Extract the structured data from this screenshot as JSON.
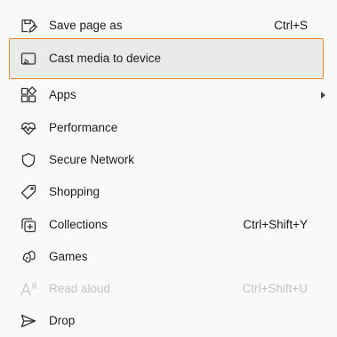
{
  "menu": {
    "items": [
      {
        "label": "Save page as",
        "shortcut": "Ctrl+S",
        "icon": "save-icon"
      },
      {
        "label": "Cast media to device",
        "shortcut": "",
        "icon": "cast-icon"
      },
      {
        "label": "Apps",
        "shortcut": "",
        "icon": "apps-icon",
        "has_submenu": true
      },
      {
        "label": "Performance",
        "shortcut": "",
        "icon": "performance-icon"
      },
      {
        "label": "Secure Network",
        "shortcut": "",
        "icon": "shield-icon"
      },
      {
        "label": "Shopping",
        "shortcut": "",
        "icon": "tag-icon"
      },
      {
        "label": "Collections",
        "shortcut": "Ctrl+Shift+Y",
        "icon": "collections-icon"
      },
      {
        "label": "Games",
        "shortcut": "",
        "icon": "games-icon"
      },
      {
        "label": "Read aloud",
        "shortcut": "Ctrl+Shift+U",
        "icon": "read-aloud-icon",
        "disabled": true
      },
      {
        "label": "Drop",
        "shortcut": "",
        "icon": "send-icon"
      }
    ]
  },
  "colors": {
    "selected_border": "#e8862a",
    "selected_background": "#eaeaea",
    "disabled_text": "#c4c4c4"
  }
}
